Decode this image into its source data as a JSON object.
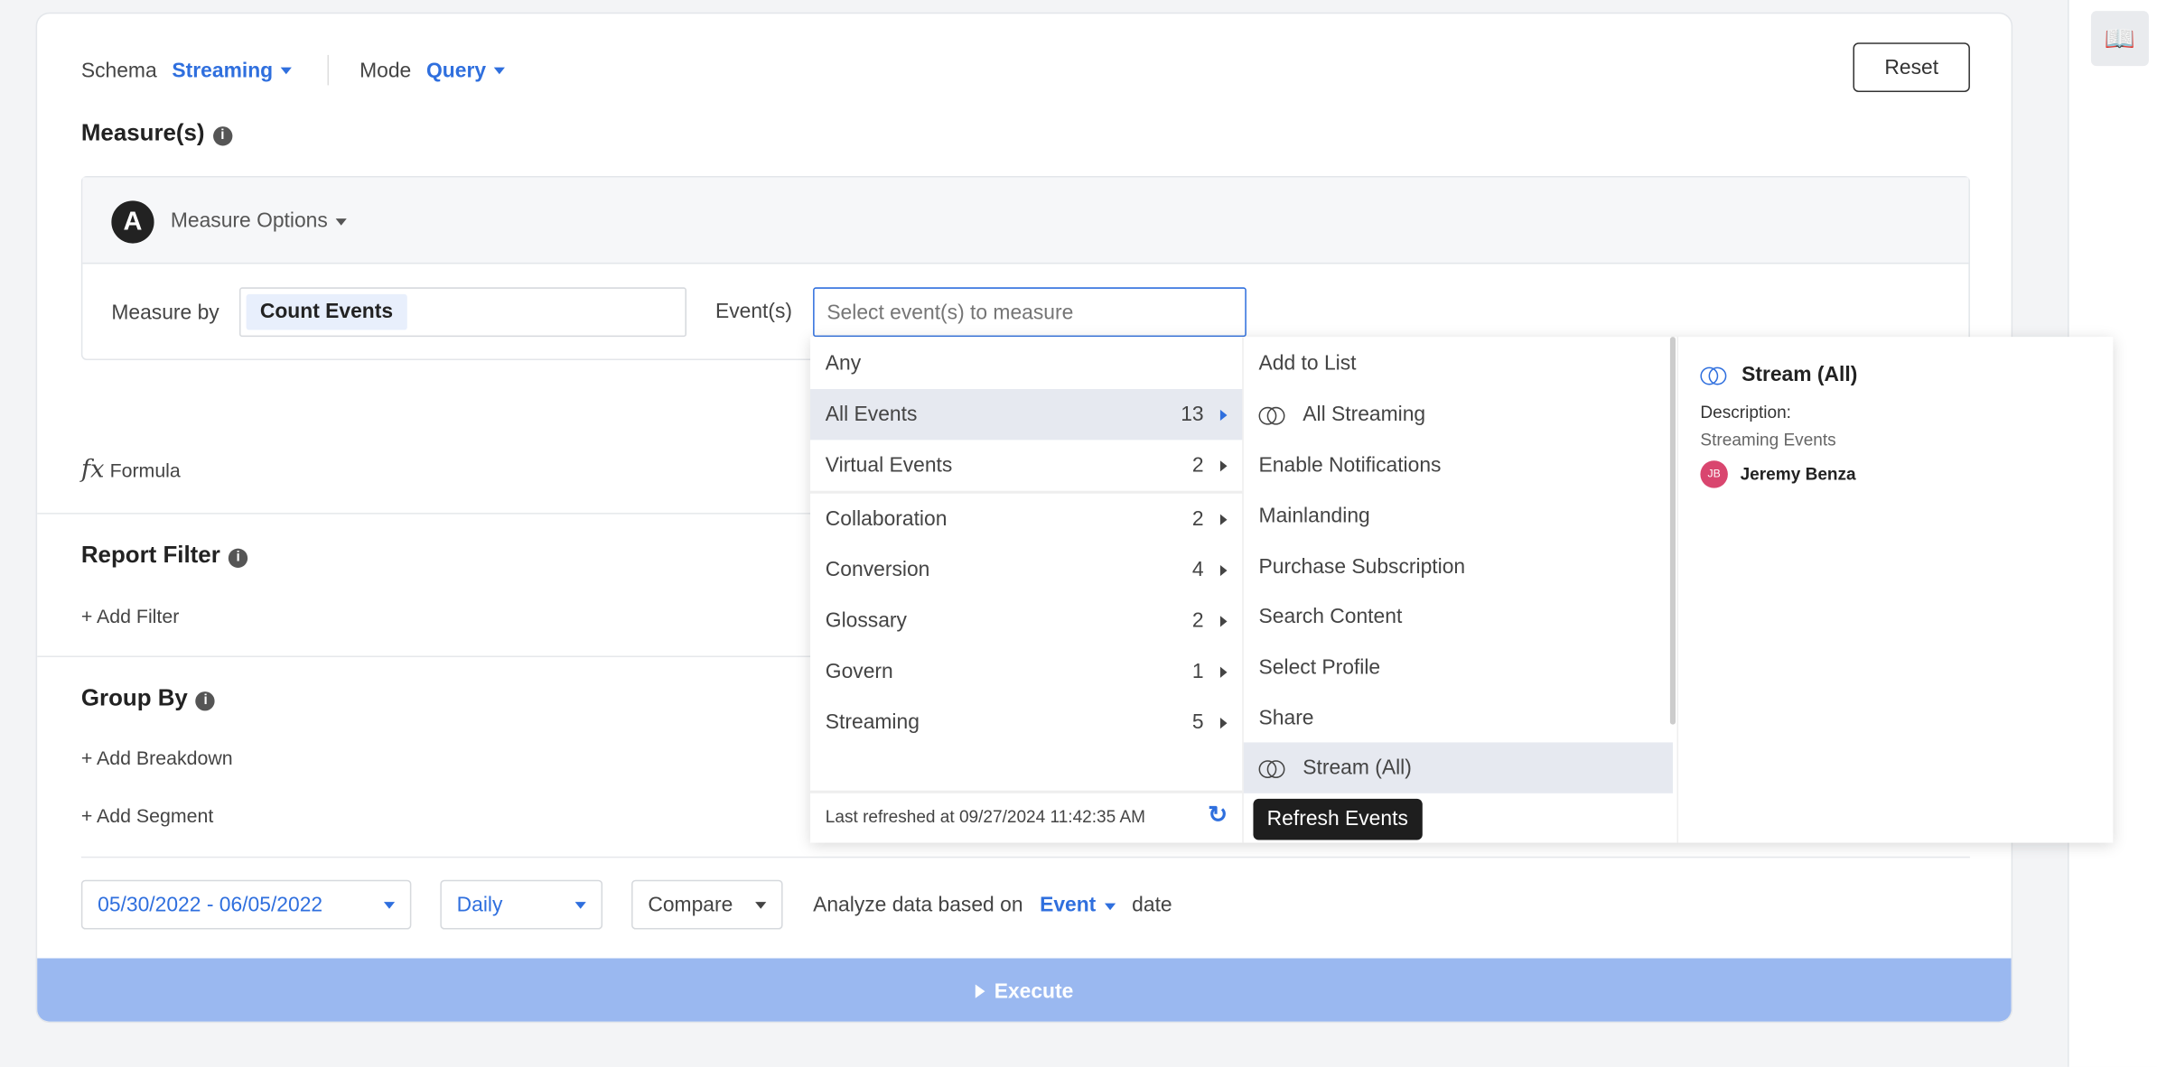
{
  "header": {
    "schema_label": "Schema",
    "schema_value": "Streaming",
    "mode_label": "Mode",
    "mode_value": "Query",
    "reset": "Reset"
  },
  "measures": {
    "title": "Measure(s)",
    "badge": "A",
    "options": "Measure Options",
    "measure_by_label": "Measure by",
    "measure_by_value": "Count Events",
    "events_label": "Event(s)",
    "events_placeholder": "Select event(s) to measure"
  },
  "formula": {
    "icon": "fx",
    "label": "Formula"
  },
  "report_filter": {
    "title": "Report Filter",
    "add": "+ Add Filter"
  },
  "group_by": {
    "title": "Group By",
    "add_breakdown": "+ Add Breakdown",
    "add_segment": "+ Add Segment"
  },
  "footer": {
    "date_range": "05/30/2022 - 06/05/2022",
    "interval": "Daily",
    "compare": "Compare",
    "analyze_prefix": "Analyze data based on",
    "analyze_value": "Event",
    "analyze_suffix": "date",
    "execute": "Execute"
  },
  "dropdown": {
    "categories": [
      {
        "label": "Any"
      },
      {
        "label": "All Events",
        "count": "13"
      },
      {
        "label": "Virtual Events",
        "count": "2"
      },
      {
        "label": "Collaboration",
        "count": "2"
      },
      {
        "label": "Conversion",
        "count": "4"
      },
      {
        "label": "Glossary",
        "count": "2"
      },
      {
        "label": "Govern",
        "count": "1"
      },
      {
        "label": "Streaming",
        "count": "5"
      }
    ],
    "events": [
      {
        "label": "Add to List"
      },
      {
        "label": "All Streaming",
        "icon": "virtual"
      },
      {
        "label": "Enable Notifications"
      },
      {
        "label": "Mainlanding"
      },
      {
        "label": "Purchase Subscription"
      },
      {
        "label": "Search Content"
      },
      {
        "label": "Select Profile"
      },
      {
        "label": "Share"
      },
      {
        "label": "Stream (All)",
        "icon": "virtual"
      }
    ],
    "last_refreshed": "Last refreshed at 09/27/2024 11:42:35 AM",
    "tooltip": "Refresh Events",
    "detail": {
      "title": "Stream (All)",
      "description_label": "Description:",
      "description": "Streaming Events",
      "owner_initials": "JB",
      "owner": "Jeremy Benza"
    }
  },
  "colors": {
    "accent": "#2f6fde",
    "execute": "#9ab8f0",
    "selected_row": "#e6e9f0",
    "avatar": "#d9466f"
  }
}
